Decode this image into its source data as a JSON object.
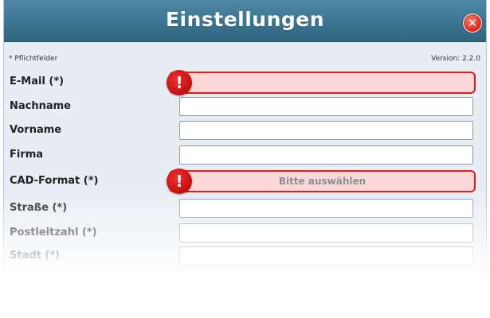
{
  "dialog": {
    "title": "Einstellungen",
    "close_icon": "close-icon",
    "required_note": "* Pflichtfelder",
    "version": "Version: 2.2.0"
  },
  "form": {
    "email": {
      "label": "E-Mail (*)",
      "value": "",
      "state": "error"
    },
    "lastname": {
      "label": "Nachname",
      "value": ""
    },
    "firstname": {
      "label": "Vorname",
      "value": ""
    },
    "company": {
      "label": "Firma",
      "value": ""
    },
    "cad_format": {
      "label": "CAD-Format (*)",
      "selected": "Bitte auswählen",
      "state": "error"
    },
    "street": {
      "label": "Straße (*)",
      "value": ""
    },
    "zip": {
      "label": "Postleitzahl (*)",
      "value": ""
    },
    "city": {
      "label": "Stadt (*)",
      "value": ""
    }
  },
  "colors": {
    "titlebar": "#3a7592",
    "error_border": "#e01d1d",
    "error_fill": "#fbd7d7"
  }
}
